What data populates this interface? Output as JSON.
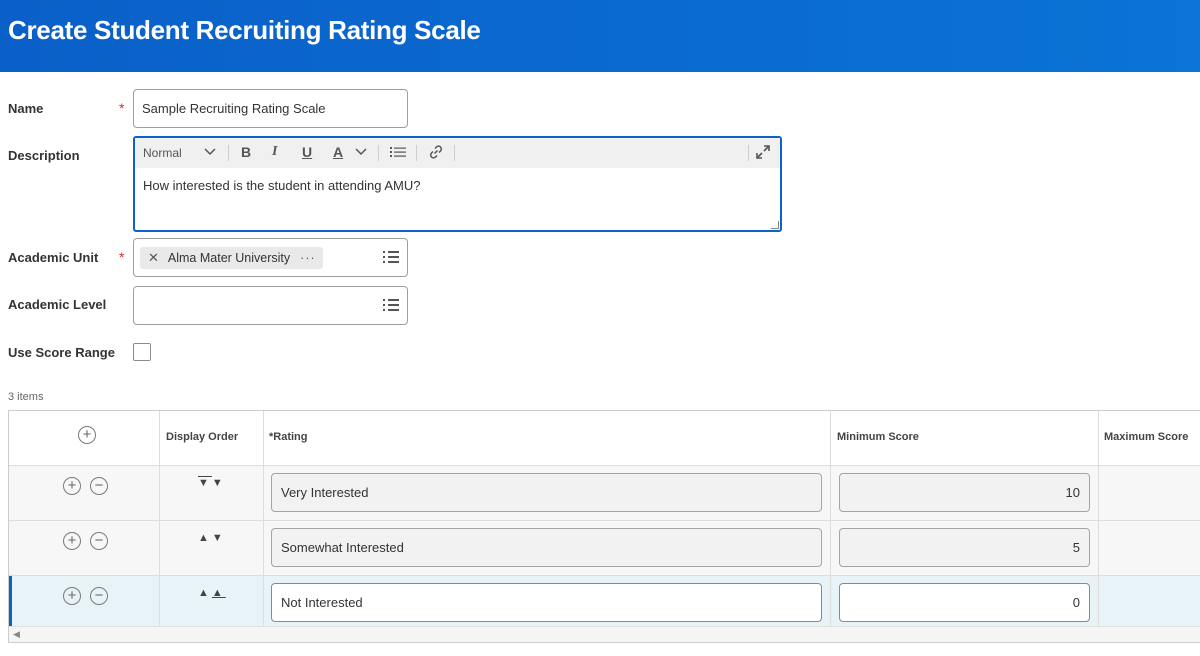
{
  "header": {
    "title": "Create Student Recruiting Rating Scale"
  },
  "form": {
    "name_label": "Name",
    "name_value": "Sample Recruiting Rating Scale",
    "required_mark": "*",
    "description_label": "Description",
    "toolbar": {
      "style_select": "Normal",
      "bold": "B",
      "italic": "I",
      "underline": "U",
      "font_color": "A"
    },
    "description_value": "How interested is the student in attending AMU?",
    "academic_unit_label": "Academic Unit",
    "academic_unit_value": "Alma Mater University",
    "academic_level_label": "Academic Level",
    "use_score_range_label": "Use Score Range",
    "use_score_range_checked": false
  },
  "grid": {
    "items_count": "3 items",
    "columns": [
      "Display Order",
      "*Rating",
      "Minimum Score",
      "Maximum Score"
    ],
    "rows": [
      {
        "rating": "Very Interested",
        "min": "10"
      },
      {
        "rating": "Somewhat Interested",
        "min": "5"
      },
      {
        "rating": "Not Interested",
        "min": "0"
      }
    ]
  },
  "colors": {
    "header_bg": "#0a6bd0",
    "required": "#de2c2c",
    "selected_row": "#e8f3f8",
    "accent": "#0a64c7"
  }
}
